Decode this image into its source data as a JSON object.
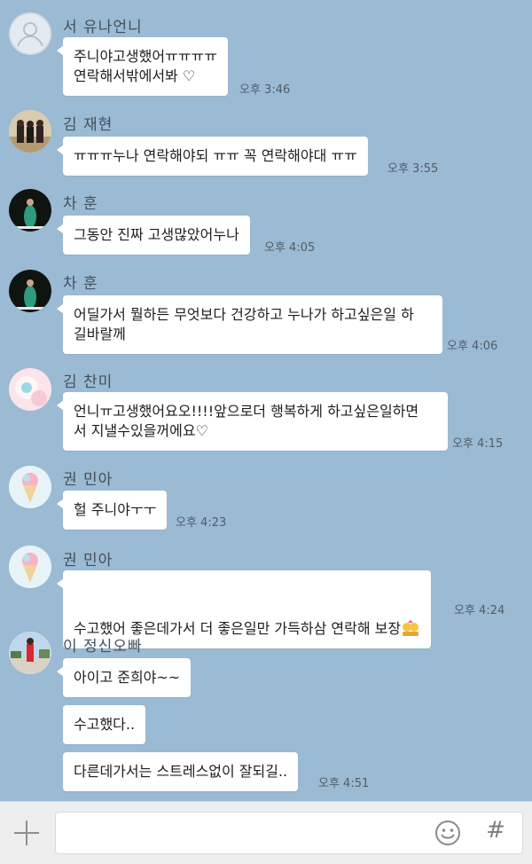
{
  "messages": [
    {
      "sender": "서 유나언니",
      "lines": [
        "주니야고생했어ㅠㅠㅠㅠ\n연락해서밖에서봐 ♡"
      ],
      "time": "오후 3:46"
    },
    {
      "sender": "김 재현",
      "lines": [
        "ㅠㅠㅠ누나 연락해야되 ㅠㅠ 꼭 연락해야대 ㅠㅠ"
      ],
      "time": "오후 3:55"
    },
    {
      "sender": "차 훈",
      "lines": [
        "그동안 진짜 고생많았어누나"
      ],
      "time": "오후 4:05"
    },
    {
      "sender": "차 훈",
      "lines": [
        "어딜가서 뭘하든 무엇보다 건강하고 누나가 하고싶은일 하\n길바랄께"
      ],
      "time": "오후 4:06"
    },
    {
      "sender": "김 찬미",
      "lines": [
        "언니ㅠ고생했어요오!!!!앞으로더 행복하게 하고싶은일하면\n서 지낼수있을꺼에요♡"
      ],
      "time": "오후 4:15"
    },
    {
      "sender": "권 민아",
      "lines": [
        "헐 주니야ㅜㅜ"
      ],
      "time": "오후 4:23"
    },
    {
      "sender": "권 민아",
      "lines": [
        "수고했어 좋은데가서 더 좋은일만 가득하삼 연락해 보장"
      ],
      "time": "오후 4:24"
    },
    {
      "sender": "이 정신오빠",
      "lines": [
        "아이고 준희야~~",
        "수고했다..",
        "다른데가서는 스트레스없이 잘되길.."
      ],
      "time": "오후 4:51"
    }
  ],
  "colors": {
    "background": "#9bbad3",
    "bubble": "#ffffff",
    "input_bar": "#eeeeee"
  },
  "input": {
    "placeholder": ""
  },
  "icons": {
    "attach": "plus-icon",
    "emoji": "smiley-icon",
    "hashtag": "hash-icon",
    "hash_glyph": "#"
  }
}
